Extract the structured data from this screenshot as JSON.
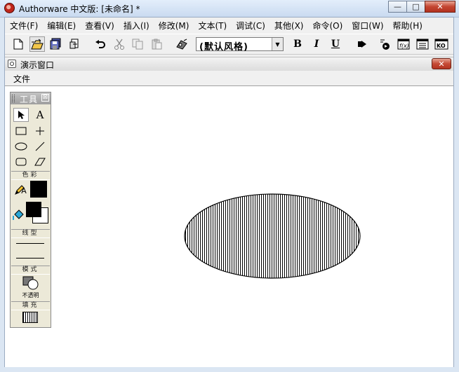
{
  "window": {
    "title": "Authorware 中文版: [未命名] *",
    "minimize": "—",
    "maximize": "□",
    "close": "✕"
  },
  "menu": [
    "文件(F)",
    "编辑(E)",
    "查看(V)",
    "插入(I)",
    "修改(M)",
    "文本(T)",
    "调试(C)",
    "其他(X)",
    "命令(O)",
    "窗口(W)",
    "帮助(H)"
  ],
  "toolbar": {
    "style_value": "(默认风格)",
    "bold": "B",
    "italic": "I",
    "underline": "U",
    "icons": [
      "new-icon",
      "open-icon",
      "save-all-icon",
      "import-icon",
      "undo-icon",
      "cut-icon",
      "copy-icon",
      "paste-icon",
      "find-icon",
      "style-dropdown",
      "bold-icon",
      "italic-icon",
      "underline-icon",
      "run-icon",
      "control-panel-icon",
      "functions-icon",
      "variables-icon",
      "knowledge-objects-icon"
    ],
    "fn_label": "f(x)",
    "ko_label": "KO"
  },
  "presentation": {
    "title": "演示窗口",
    "close": "✕",
    "menu_file": "文件"
  },
  "palette": {
    "title": "工具",
    "close": "⊠",
    "sections": {
      "color": "色彩",
      "line": "线型",
      "mode": "模式",
      "fill": "填充"
    },
    "mode_value": "不透明",
    "text_tool": "A",
    "pen_label": "A"
  },
  "colors": {
    "accent": "#c0261b",
    "stage": "#ffffff",
    "ellipse_stroke": "#000000"
  }
}
